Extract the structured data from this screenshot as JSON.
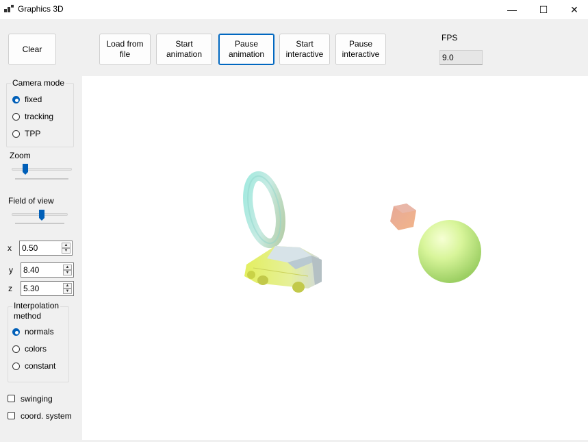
{
  "window": {
    "title": "Graphics 3D",
    "minimize_label": "—",
    "maximize_label": "☐",
    "close_label": "✕"
  },
  "toolbar": {
    "clear": "Clear",
    "load": "Load from\nfile",
    "start_animation": "Start\nanimation",
    "pause_animation": "Pause\nanimation",
    "start_interactive": "Start\ninteractive",
    "pause_interactive": "Pause\ninteractive",
    "fps_label": "FPS",
    "fps_value": "9.0"
  },
  "camera": {
    "title": "Camera mode",
    "options": [
      "fixed",
      "tracking",
      "TPP"
    ],
    "selected": "fixed"
  },
  "zoom": {
    "label": "Zoom"
  },
  "fov": {
    "label": "Field of view"
  },
  "coords": {
    "x_label": "x",
    "x_value": "0.50",
    "y_label": "y",
    "y_value": "8.40",
    "z_label": "z",
    "z_value": "5.30"
  },
  "interpolation": {
    "title": "Interpolation\nmethod",
    "options": [
      "normals",
      "colors",
      "constant"
    ],
    "selected": "normals"
  },
  "options": {
    "swinging": "swinging",
    "coord_system": "coord. system"
  },
  "colors": {
    "accent": "#005fb8",
    "sphere": "#d8f59a",
    "car": "#e7f07a",
    "torus": "#a5e3d2",
    "cube": "#f0a08a"
  },
  "icons": {
    "app": "app-icon",
    "spin_up": "▲",
    "spin_down": "▼"
  }
}
